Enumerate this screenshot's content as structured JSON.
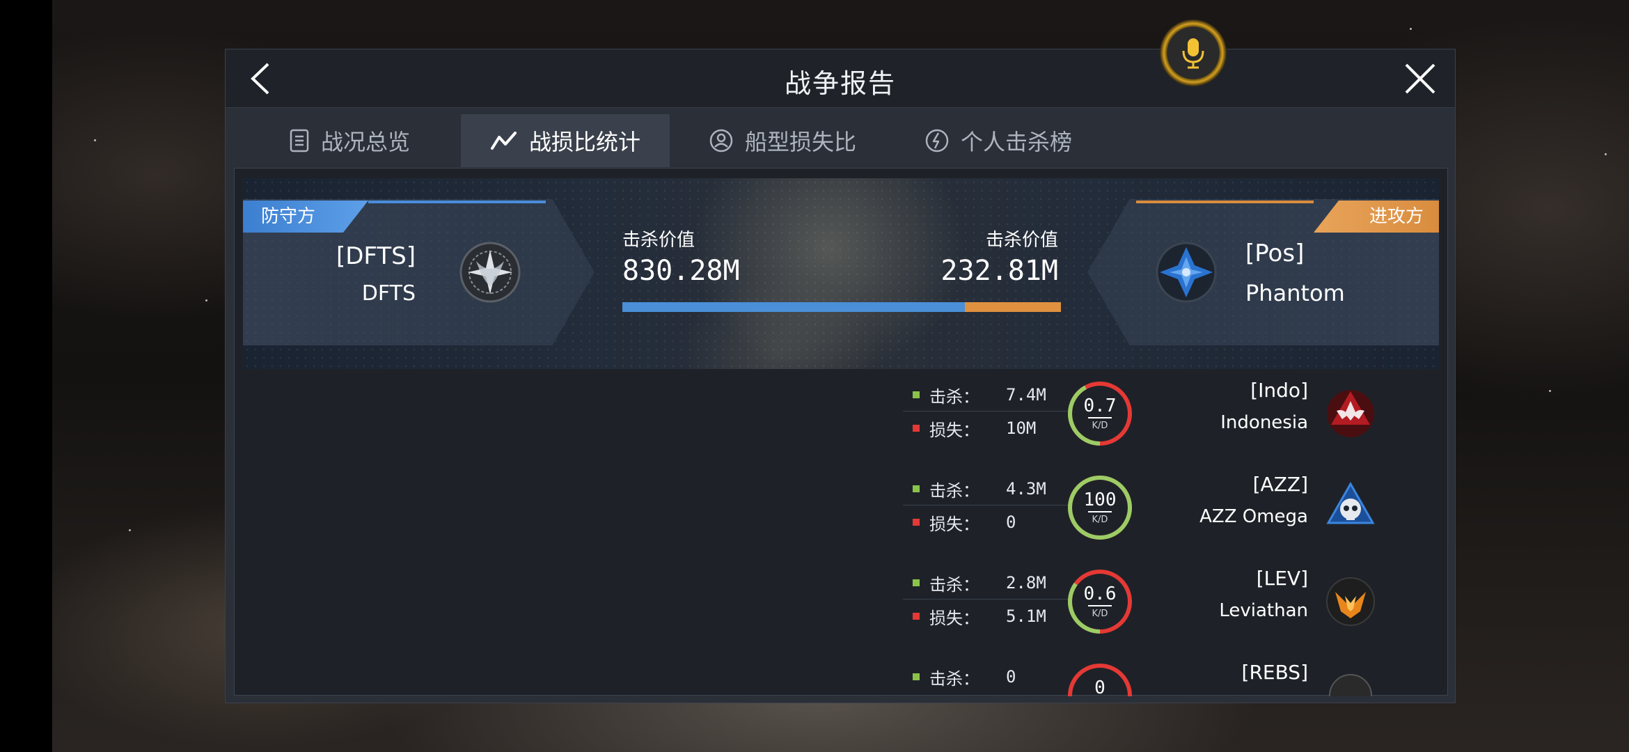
{
  "header": {
    "title": "战争报告"
  },
  "tabs": [
    {
      "label": "战况总览",
      "icon": "list-icon",
      "active": false
    },
    {
      "label": "战损比统计",
      "icon": "trend-line-icon",
      "active": true
    },
    {
      "label": "船型损失比",
      "icon": "ship-ratio-icon",
      "active": false
    },
    {
      "label": "个人击杀榜",
      "icon": "lightning-icon",
      "active": false
    }
  ],
  "summary": {
    "defender": {
      "side_label": "防守方",
      "tag": "[DFTS]",
      "name": "DFTS",
      "kill_value_label": "击杀价值",
      "kill_value": "830.28M",
      "color": "#4a8fd8"
    },
    "attacker": {
      "side_label": "进攻方",
      "tag": "[Pos]",
      "name": "Phantom",
      "kill_value_label": "击杀价值",
      "kill_value": "232.81M",
      "color": "#e0913f"
    },
    "defender_share": 0.781
  },
  "stat_labels": {
    "kills": "击杀：",
    "losses": "损失：",
    "kd": "K/D"
  },
  "colors": {
    "kill_marker": "#8bc34a",
    "loss_marker": "#e53935",
    "ring_green": "#9ccc65",
    "ring_red": "#e53935"
  },
  "corporations": [
    {
      "tag": "[Indo]",
      "name": "Indonesia",
      "kills": "7.4M",
      "losses": "10M",
      "kd": "0.7",
      "green_fraction": 0.42,
      "emblem": "winged-skull-red-emblem"
    },
    {
      "tag": "[AZZ]",
      "name": "AZZ Omega",
      "kills": "4.3M",
      "losses": "0",
      "kd": "100",
      "green_fraction": 1.0,
      "emblem": "skull-blue-emblem"
    },
    {
      "tag": "[LEV]",
      "name": "Leviathan",
      "kills": "2.8M",
      "losses": "5.1M",
      "kd": "0.6",
      "green_fraction": 0.35,
      "emblem": "flame-orange-emblem"
    },
    {
      "tag": "[REBS]",
      "name": "",
      "kills": "0",
      "losses": "",
      "kd": "0",
      "green_fraction": 0.0,
      "emblem": "rebs-emblem"
    }
  ]
}
